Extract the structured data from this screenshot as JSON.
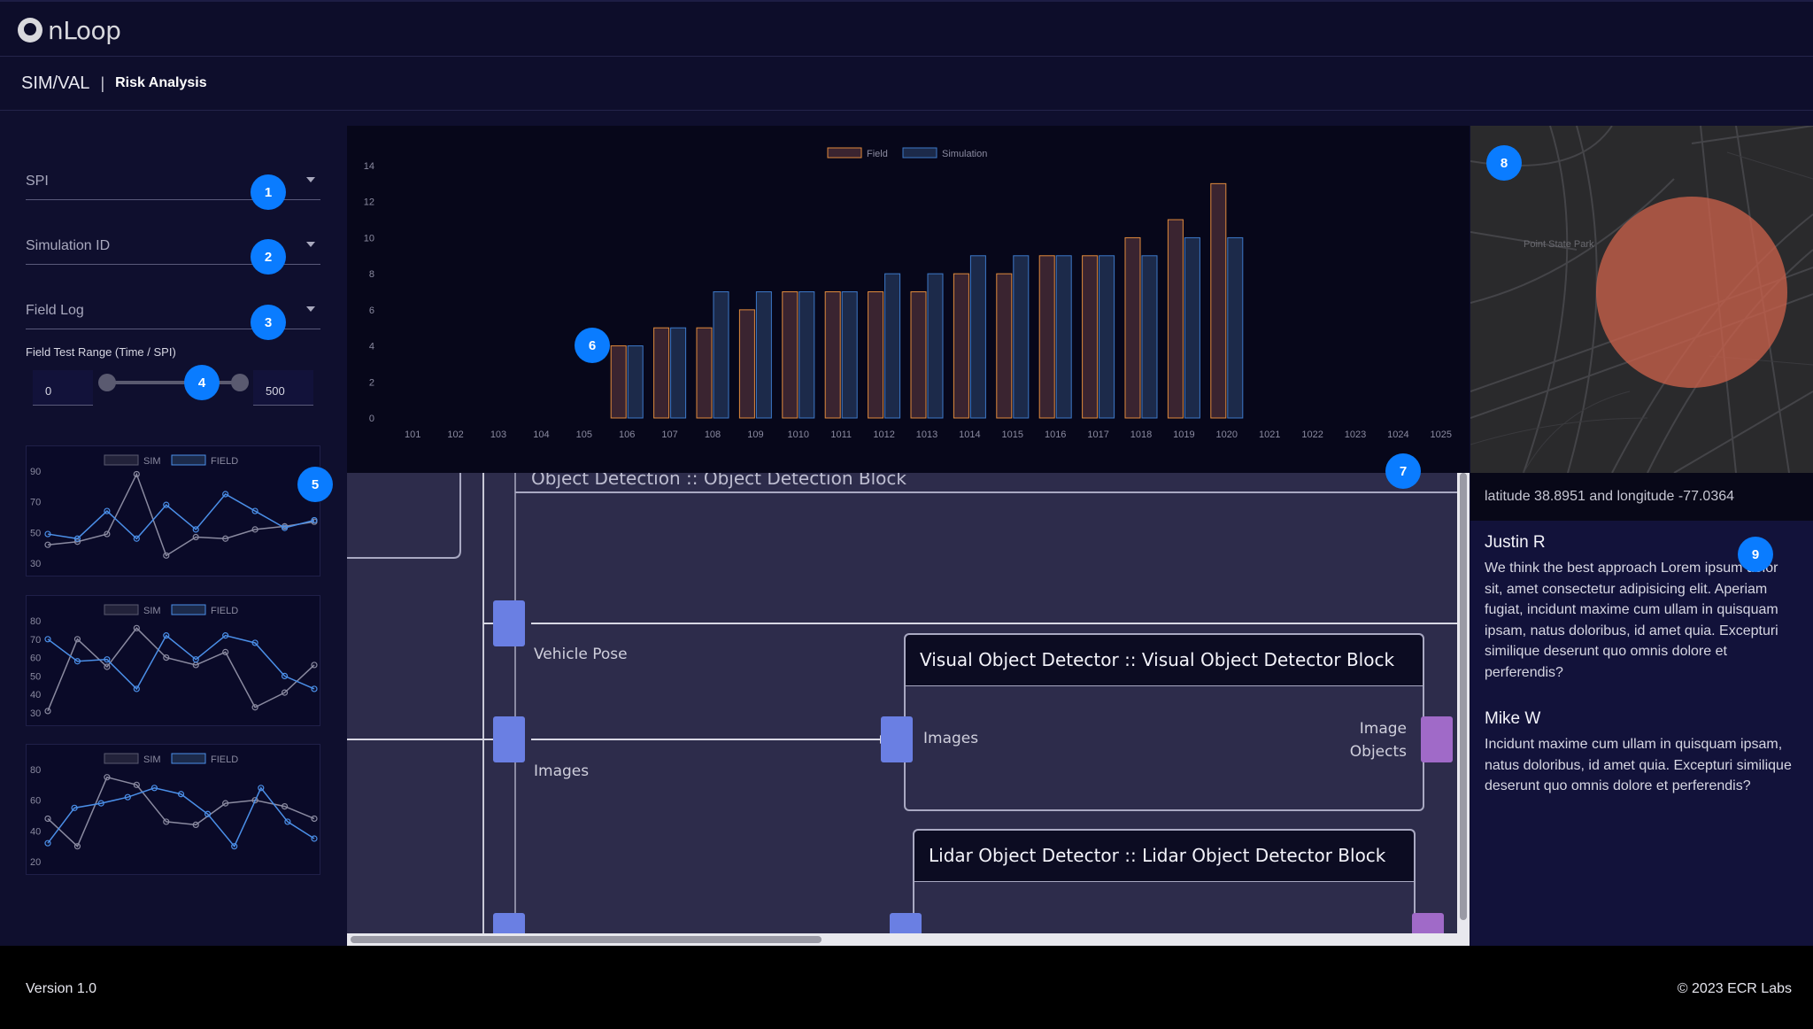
{
  "app": {
    "logo_text": "nLoop"
  },
  "header": {
    "section": "SIM/VAL",
    "separator": "|",
    "page": "Risk Analysis"
  },
  "sidebar": {
    "dropdowns": [
      {
        "label": "SPI"
      },
      {
        "label": "Simulation ID"
      },
      {
        "label": "Field Log"
      }
    ],
    "range": {
      "label": "Field Test Range (Time / SPI)",
      "min_value": "0",
      "max_value": "500"
    },
    "mini_charts": [
      {
        "legend": [
          "SIM",
          "FIELD"
        ],
        "yticks": [
          "90",
          "70",
          "50",
          "30"
        ]
      },
      {
        "legend": [
          "SIM",
          "FIELD"
        ],
        "yticks": [
          "80",
          "70",
          "60",
          "50",
          "40",
          "30"
        ]
      },
      {
        "legend": [
          "SIM",
          "FIELD"
        ],
        "yticks": [
          "80",
          "60",
          "40",
          "20"
        ]
      }
    ]
  },
  "badges": [
    "1",
    "2",
    "3",
    "4",
    "5",
    "6",
    "7",
    "8",
    "9"
  ],
  "chart_data": [
    {
      "type": "bar",
      "title": "",
      "categories": [
        "101",
        "102",
        "103",
        "104",
        "105",
        "106",
        "107",
        "108",
        "109",
        "1010",
        "1011",
        "1012",
        "1013",
        "1014",
        "1015",
        "1016",
        "1017",
        "1018",
        "1019",
        "1020",
        "1021",
        "1022",
        "1023",
        "1024",
        "1025"
      ],
      "series": [
        {
          "name": "Field",
          "color": "#e08a3c",
          "values": [
            null,
            null,
            null,
            null,
            null,
            4,
            5,
            5,
            6,
            7,
            7,
            7,
            7,
            8,
            8,
            9,
            9,
            10,
            11,
            13,
            null,
            null,
            null,
            null,
            null
          ]
        },
        {
          "name": "Simulation",
          "color": "#3c78c8",
          "values": [
            null,
            null,
            null,
            null,
            null,
            4,
            5,
            7,
            7,
            7,
            7,
            8,
            8,
            9,
            9,
            9,
            9,
            9,
            10,
            10,
            null,
            null,
            null,
            null,
            null
          ]
        }
      ],
      "yticks": [
        "0",
        "2",
        "4",
        "6",
        "8",
        "10",
        "12",
        "14"
      ],
      "ylim": [
        0,
        14
      ],
      "legend_position": "top-center",
      "grid": false
    },
    {
      "type": "line",
      "series": [
        {
          "name": "SIM",
          "color": "#8a8aa0",
          "values": [
            42,
            44,
            49,
            88,
            35,
            47,
            46,
            52,
            54,
            57
          ]
        },
        {
          "name": "FIELD",
          "color": "#4b8fe8",
          "values": [
            49,
            46,
            64,
            46,
            68,
            52,
            75,
            64,
            53,
            58
          ]
        }
      ],
      "ylim": [
        30,
        90
      ]
    },
    {
      "type": "line",
      "series": [
        {
          "name": "SIM",
          "color": "#8a8aa0",
          "values": [
            31,
            70,
            55,
            76,
            60,
            56,
            63,
            33,
            41,
            56
          ]
        },
        {
          "name": "FIELD",
          "color": "#4b8fe8",
          "values": [
            70,
            58,
            59,
            43,
            72,
            59,
            72,
            68,
            50,
            43
          ]
        }
      ],
      "ylim": [
        30,
        80
      ]
    },
    {
      "type": "line",
      "series": [
        {
          "name": "SIM",
          "color": "#8a8aa0",
          "values": [
            48,
            30,
            75,
            70,
            46,
            44,
            58,
            60,
            56,
            48
          ]
        },
        {
          "name": "FIELD",
          "color": "#4b8fe8",
          "values": [
            32,
            55,
            58,
            62,
            68,
            64,
            51,
            30,
            68,
            46,
            35
          ]
        }
      ],
      "ylim": [
        20,
        80
      ]
    }
  ],
  "diagram": {
    "partial_title": "Object Detection :: Object Detection Block",
    "vehicle_pose_label": "Vehicle Pose",
    "images_label": "Images",
    "visual_block": {
      "title": "Visual Object Detector :: Visual Object Detector Block",
      "in_port": "Images",
      "out_port_line1": "Image",
      "out_port_line2": "Objects"
    },
    "lidar_block": {
      "title": "Lidar Object Detector :: Lidar Object Detector Block"
    }
  },
  "map": {
    "labels": [
      "Point State Park"
    ],
    "location_text": "latitude 38.8951 and longitude -77.0364",
    "circle_color": "#c8604a"
  },
  "comments": [
    {
      "author": "Justin R",
      "text": "We think the best approach Lorem ipsum dolor sit, amet consectetur adipisicing elit. Aperiam fugiat, incidunt maxime cum ullam in quisquam ipsam, natus doloribus, id amet quia. Excepturi similique deserunt quo omnis dolore et perferendis?"
    },
    {
      "author": "Mike W",
      "text": "Incidunt maxime cum ullam in quisquam ipsam, natus doloribus, id amet quia. Excepturi similique deserunt quo omnis dolore et perferendis?"
    }
  ],
  "footer": {
    "version": "Version 1.0",
    "copyright": "© 2023 ECR Labs"
  }
}
